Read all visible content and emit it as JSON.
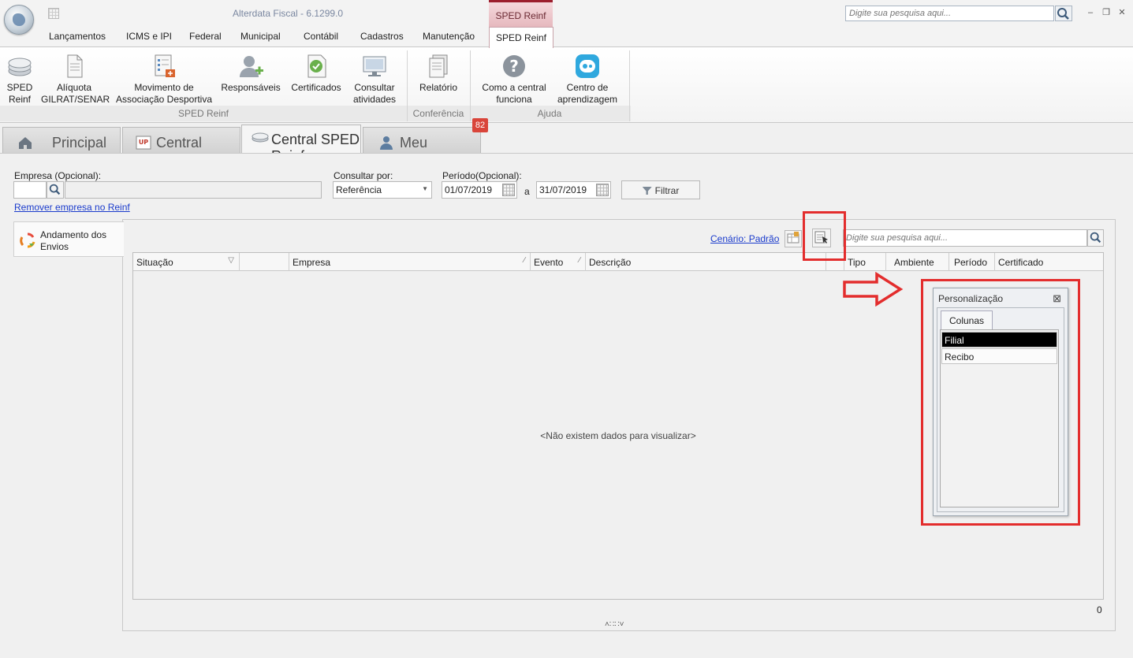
{
  "titlebar": {
    "app_title": "Alterdata Fiscal - 6.1299.0",
    "context_tab": "SPED Reinf",
    "search_placeholder": "Digite sua pesquisa aqui..."
  },
  "menu": [
    "Lançamentos",
    "ICMS e IPI",
    "Federal",
    "Municipal",
    "Contábil",
    "Cadastros",
    "Manutenção",
    "SPED Reinf"
  ],
  "ribbon": {
    "buttons": [
      {
        "line1": "SPED",
        "line2": "Reinf"
      },
      {
        "line1": "Alíquota",
        "line2": "GILRAT/SENAR"
      },
      {
        "line1": "Movimento de",
        "line2": "Associação Desportiva"
      },
      {
        "line1": "Responsáveis",
        "line2": ""
      },
      {
        "line1": "Certificados",
        "line2": ""
      },
      {
        "line1": "Consultar",
        "line2": "atividades"
      },
      {
        "line1": "Relatório",
        "line2": ""
      },
      {
        "line1": "Como a central",
        "line2": "funciona"
      },
      {
        "line1": "Centro de",
        "line2": "aprendizagem"
      }
    ],
    "groups": [
      "SPED Reinf",
      "Conferência",
      "Ajuda"
    ]
  },
  "doc_tabs": [
    "Principal",
    "Central PackUp",
    "Central SPED Reinf",
    "Meu Gerente"
  ],
  "badge": "82",
  "filters": {
    "empresa_label": "Empresa (Opcional):",
    "remover_link": "Remover empresa no Reinf",
    "consultar_label": "Consultar por:",
    "consultar_value": "Referência",
    "periodo_label": "Período(Opcional):",
    "date_from": "01/07/2019",
    "date_sep": "a",
    "date_to": "31/07/2019",
    "filter_button": "Filtrar"
  },
  "side_tab": {
    "line1": "Andamento dos",
    "line2": "Envios"
  },
  "grid_toolbar": {
    "scenario_link": "Cenário: Padrão",
    "search_placeholder": "Digite sua pesquisa aqui..."
  },
  "grid": {
    "columns": [
      "Situação",
      "",
      "Empresa",
      "Evento",
      "Descrição",
      "Tipo",
      "Ambiente",
      "Período",
      "Certificado"
    ],
    "empty_message": "<Não existem dados para visualizar>",
    "record_count": "0"
  },
  "popup": {
    "title": "Personalização",
    "tab": "Colunas",
    "items": [
      "Filial",
      "Recibo"
    ]
  },
  "colors": {
    "annotation_red": "#e32d2d",
    "context_tab_accent": "#9c1f2e",
    "link_blue": "#1a3bcc",
    "badge_red": "#d9453a"
  }
}
